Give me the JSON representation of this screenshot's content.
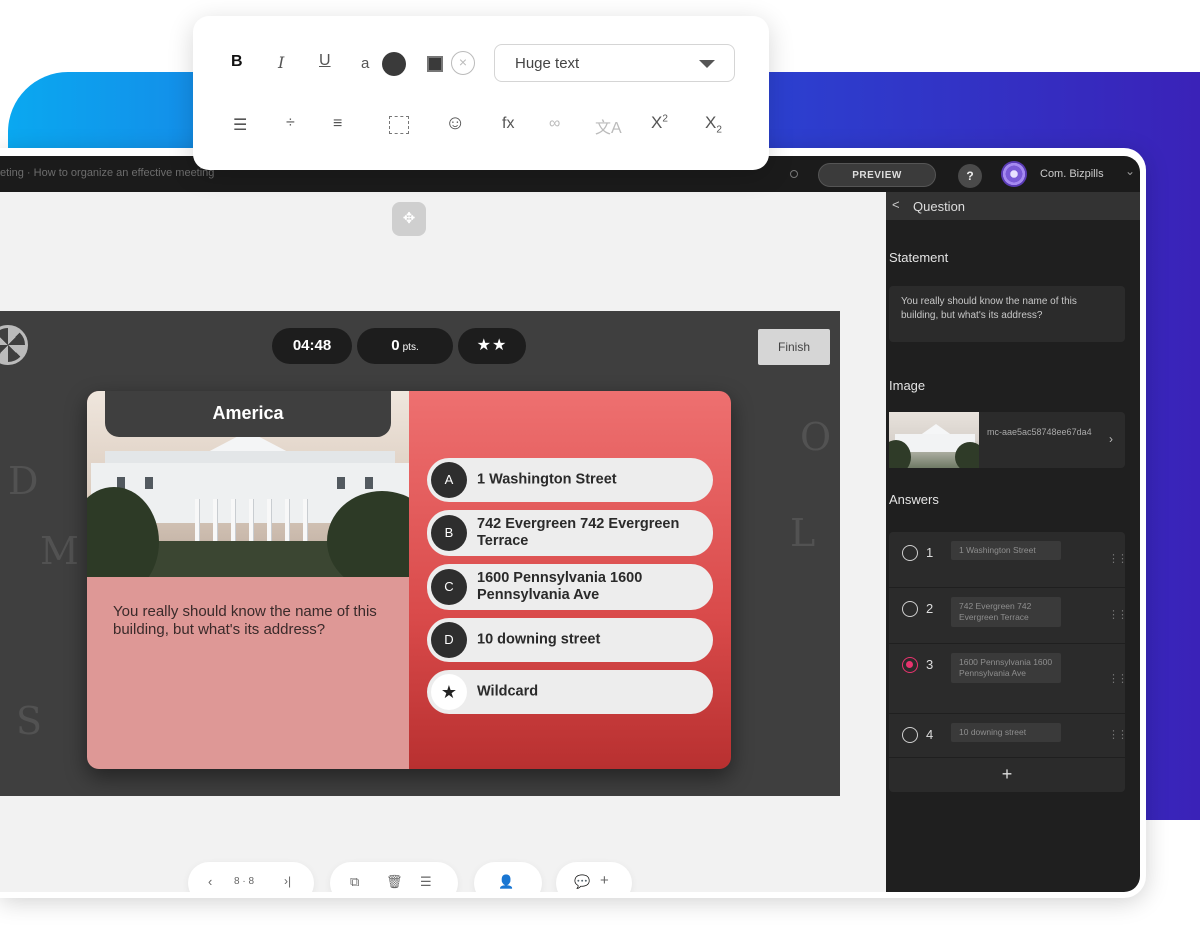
{
  "format_toolbar": {
    "bold_label": "B",
    "italic_label": "I",
    "underline_label": "U",
    "text_color_label": "a",
    "font_size_value": "Huge text",
    "superscript_label": "X",
    "superscript_exp": "2",
    "subscript_label": "X",
    "subscript_exp": "2",
    "function_label": "fx",
    "icons": [
      "bold-icon",
      "italic-icon",
      "underline-icon",
      "text-color-icon",
      "highlight-icon",
      "clear-color-icon",
      "align-left-icon",
      "line-spacing-icon",
      "list-icon",
      "frame-icon",
      "emoji-icon",
      "function-icon",
      "link-icon",
      "translate-icon",
      "superscript-icon",
      "subscript-icon"
    ]
  },
  "topbar": {
    "breadcrumb": "eting · How to organize an effective meeting",
    "preview_label": "PREVIEW",
    "help_label": "?",
    "account_name": "Com. Bizpills"
  },
  "slide": {
    "timer": "04:48",
    "points_value": "0",
    "points_unit": "pts.",
    "stars": "★★",
    "finish_label": "Finish",
    "card_title": "America",
    "statement": "You really should know the name of this building, but what's its address?",
    "answers": [
      {
        "letter": "A",
        "text": "1 Washington Street"
      },
      {
        "letter": "B",
        "text": "742 Evergreen 742 Evergreen Terrace"
      },
      {
        "letter": "C",
        "text": "1600 Pennsylvania 1600 Pennsylvania Ave"
      },
      {
        "letter": "D",
        "text": "10 downing street"
      },
      {
        "letter": "★",
        "text": "Wildcard"
      }
    ]
  },
  "bottom_toolbar": {
    "page_indicator": "8 · 8"
  },
  "panel": {
    "back_label": "<",
    "title": "Question",
    "statement_label": "Statement",
    "statement_text": "You really should know the name of this building, but what's its address?",
    "image_label": "Image",
    "image_name": "mc-aae5ac58748ee67da4",
    "answers_label": "Answers",
    "answers": [
      {
        "num": "1",
        "text": "1 Washington Street",
        "selected": false
      },
      {
        "num": "2",
        "text": "742 Evergreen 742 Evergreen Terrace",
        "selected": false
      },
      {
        "num": "3",
        "text": "1600 Pennsylvania 1600 Pennsylvania Ave",
        "selected": true
      },
      {
        "num": "4",
        "text": "10 downing street",
        "selected": false
      }
    ],
    "add_label": "+"
  },
  "colors": {
    "accent_pink": "#e8336e",
    "answers_red": "#d94a4a",
    "statement_pink": "#de9896",
    "bg_gradient_start": "#0aa8f0",
    "bg_gradient_end": "#3a22b8"
  }
}
